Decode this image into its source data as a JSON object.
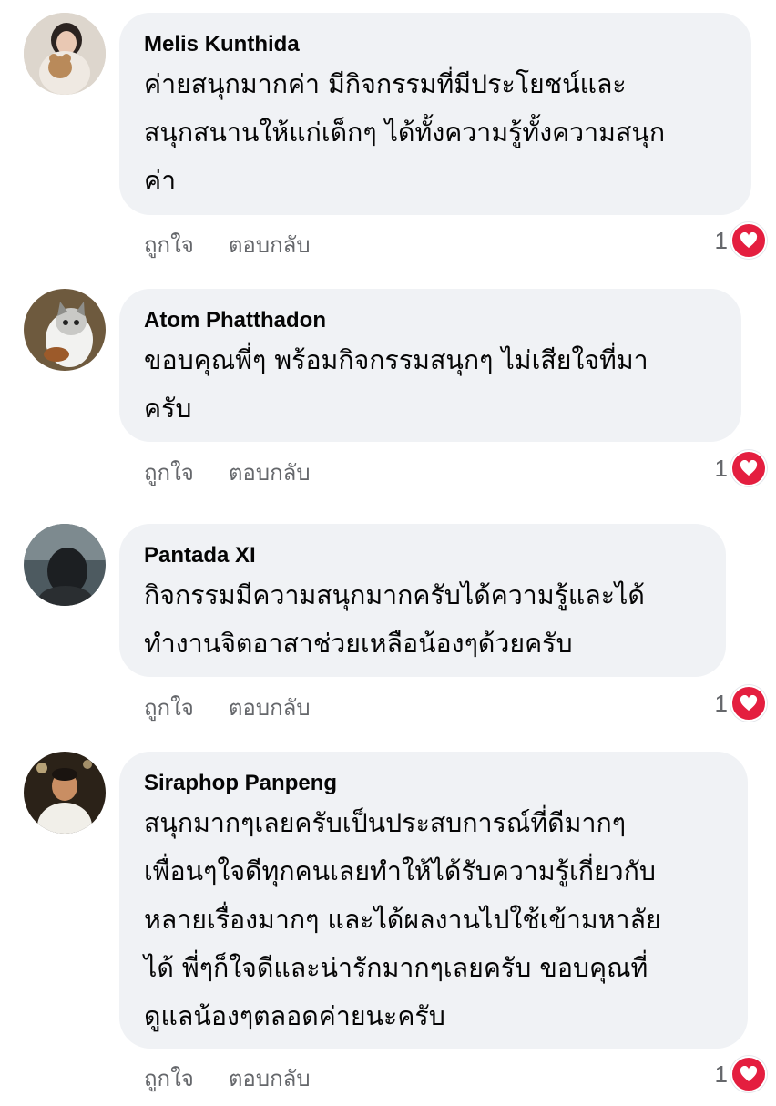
{
  "actions": {
    "like_label": "ถูกใจ",
    "reply_label": "ตอบกลับ"
  },
  "colors": {
    "bubble": "#f0f2f5",
    "heart": "#e41e3f",
    "meta_text": "#65676b"
  },
  "reaction_icon": "heart-icon",
  "comments": [
    {
      "author": "Melis Kunthida",
      "text": "ค่ายสนุกมากค่า มีกิจกรรมที่มีประโยชน์และ\nสนุกสนานให้แก่เด็กๆ ได้ทั้งความรู้ทั้งความสนุก\nค่า",
      "reaction_count": "1"
    },
    {
      "author": "Atom Phatthadon",
      "text": "ขอบคุณพี่ๆ  พร้อมกิจกรรมสนุกๆ ไม่เสียใจที่มา\nครับ",
      "reaction_count": "1"
    },
    {
      "author": "Pantada XI",
      "text": "กิจกรรมมีความสนุกมากครับได้ความรู้และได้\nทำงานจิตอาสาช่วยเหลือน้องๆด้วยครับ",
      "reaction_count": "1"
    },
    {
      "author": "Siraphop Panpeng",
      "text": "สนุกมากๆเลยครับเป็นประสบการณ์ที่ดีมากๆ\nเพื่อนๆใจดีทุกคนเลยทำให้ได้รับความรู้เกี่ยวกับ\nหลายเรื่องมากๆ และได้ผลงานไปใช้เข้ามหาลัย\nได้ พี่ๆก็ใจดีและน่ารักมากๆเลยครับ ขอบคุณที่\nดูแลน้องๆตลอดค่ายนะครับ",
      "reaction_count": "1"
    }
  ]
}
